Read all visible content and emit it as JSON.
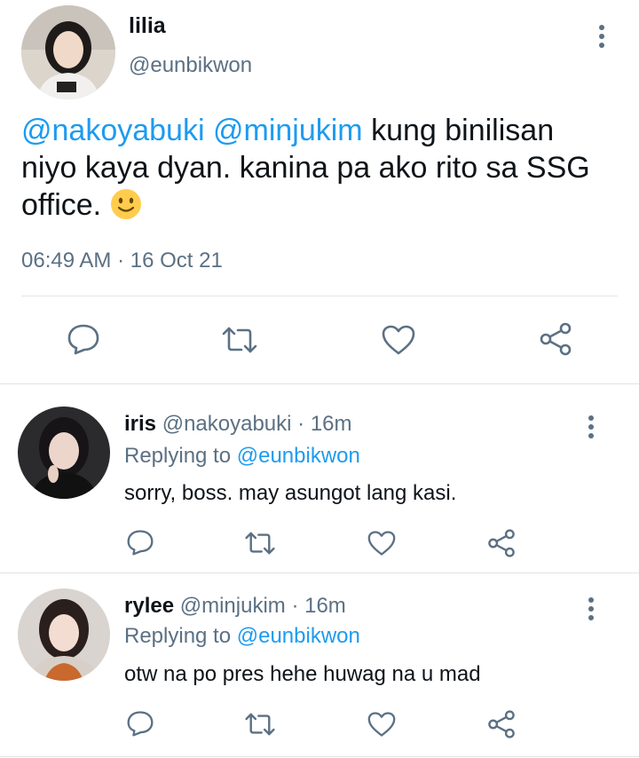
{
  "main_tweet": {
    "display_name": "lilia",
    "handle": "@eunbikwon",
    "mention_1": "@nakoyabuki",
    "mention_2": "@minjukim",
    "text_line_1": " kung binilisan",
    "text_rest": "niyo kaya dyan. kanina pa ako rito sa SSG office. ",
    "emoji": "slightly-smiling-face",
    "timestamp": "06:49 AM · 16 Oct 21"
  },
  "replies": [
    {
      "display_name": "iris",
      "handle": "@nakoyabuki",
      "time": " · 16m",
      "replying_prefix": "Replying to ",
      "replying_to": "@eunbikwon",
      "text": "sorry, boss. may asungot lang kasi."
    },
    {
      "display_name": "rylee",
      "handle": "@minjukim",
      "time": " · 16m",
      "replying_prefix": "Replying to ",
      "replying_to": "@eunbikwon",
      "text": "otw na po pres hehe huwag na u mad"
    }
  ],
  "icons": [
    "reply-icon",
    "retweet-icon",
    "like-icon",
    "share-icon",
    "more-icon"
  ],
  "colors": {
    "accent": "#1d9bf0",
    "secondary_text": "#5b7083",
    "icon": "#5b7083",
    "divider": "#e1e6ea"
  }
}
